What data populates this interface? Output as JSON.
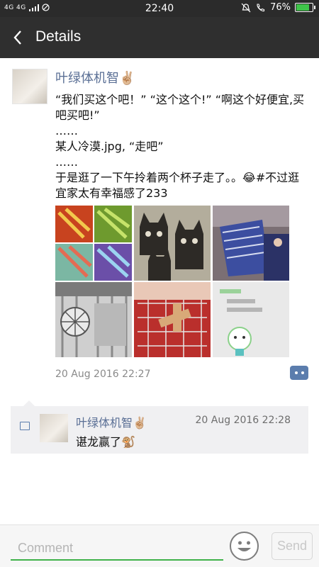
{
  "status_bar": {
    "network": "4G 4G",
    "time": "22:40",
    "battery_pct": "76%",
    "battery_level": 0.76
  },
  "header": {
    "title": "Details"
  },
  "post": {
    "author": "叶绿体机智✌🏼",
    "lines": [
      "“我们买这个吧！” “这个这个!” “啊这个好便宜,买吧买吧!”",
      "……",
      "某人冷漠.jpg, “走吧”",
      "……",
      "于是逛了一下午拎着两个杯子走了。。😂#不过逛宜家太有幸福感了233"
    ],
    "timestamp": "20 Aug 2016 22:27"
  },
  "comment": {
    "author": "叶绿体机智✌🏼",
    "time": "20 Aug 2016 22:28",
    "text": "谌龙赢了🐒"
  },
  "bottom_bar": {
    "input_placeholder": "Comment",
    "send_label": "Send"
  },
  "colors": {
    "header_bg": "#2f2f2f",
    "name_blue": "#5a6f95",
    "accent_green": "#3fb24a"
  }
}
